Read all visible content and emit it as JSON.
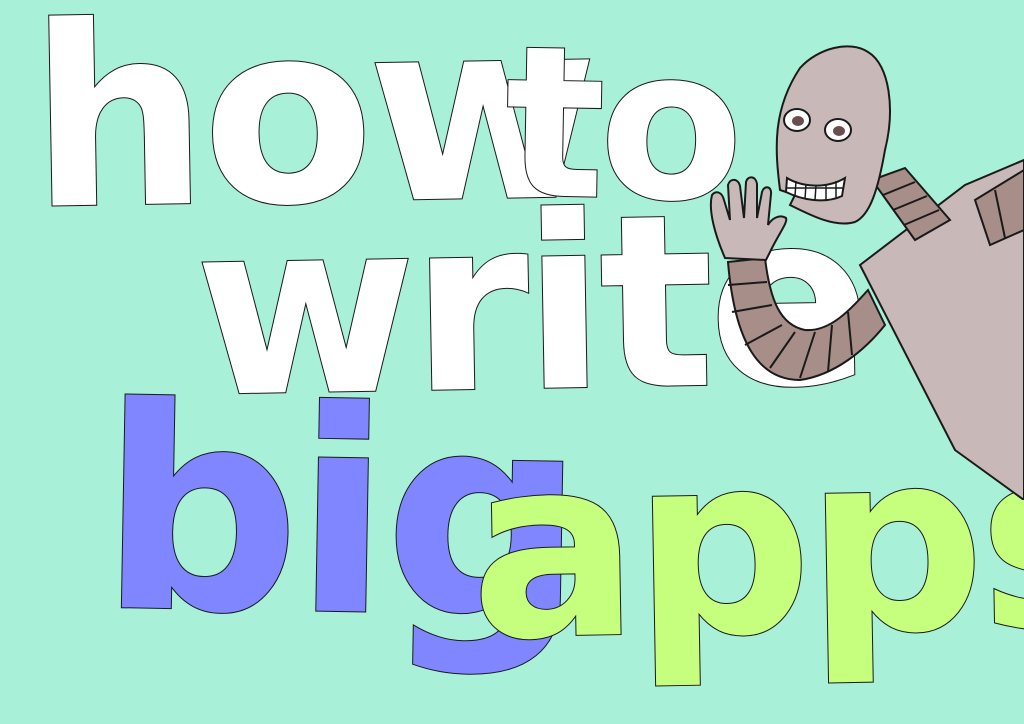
{
  "title": {
    "line1": [
      "how",
      "to"
    ],
    "line2": "write",
    "line3": [
      "big",
      "apps"
    ]
  },
  "colors": {
    "background": "#a8f0d8",
    "white_words": "#ffffff",
    "big": "#7f86ff",
    "apps": "#c6ff7e",
    "robot_body": "#c8b8b8",
    "robot_segments": "#a88e88",
    "outline": "#1a1a1a"
  },
  "illustration": {
    "character": "robot-waving-icon"
  }
}
